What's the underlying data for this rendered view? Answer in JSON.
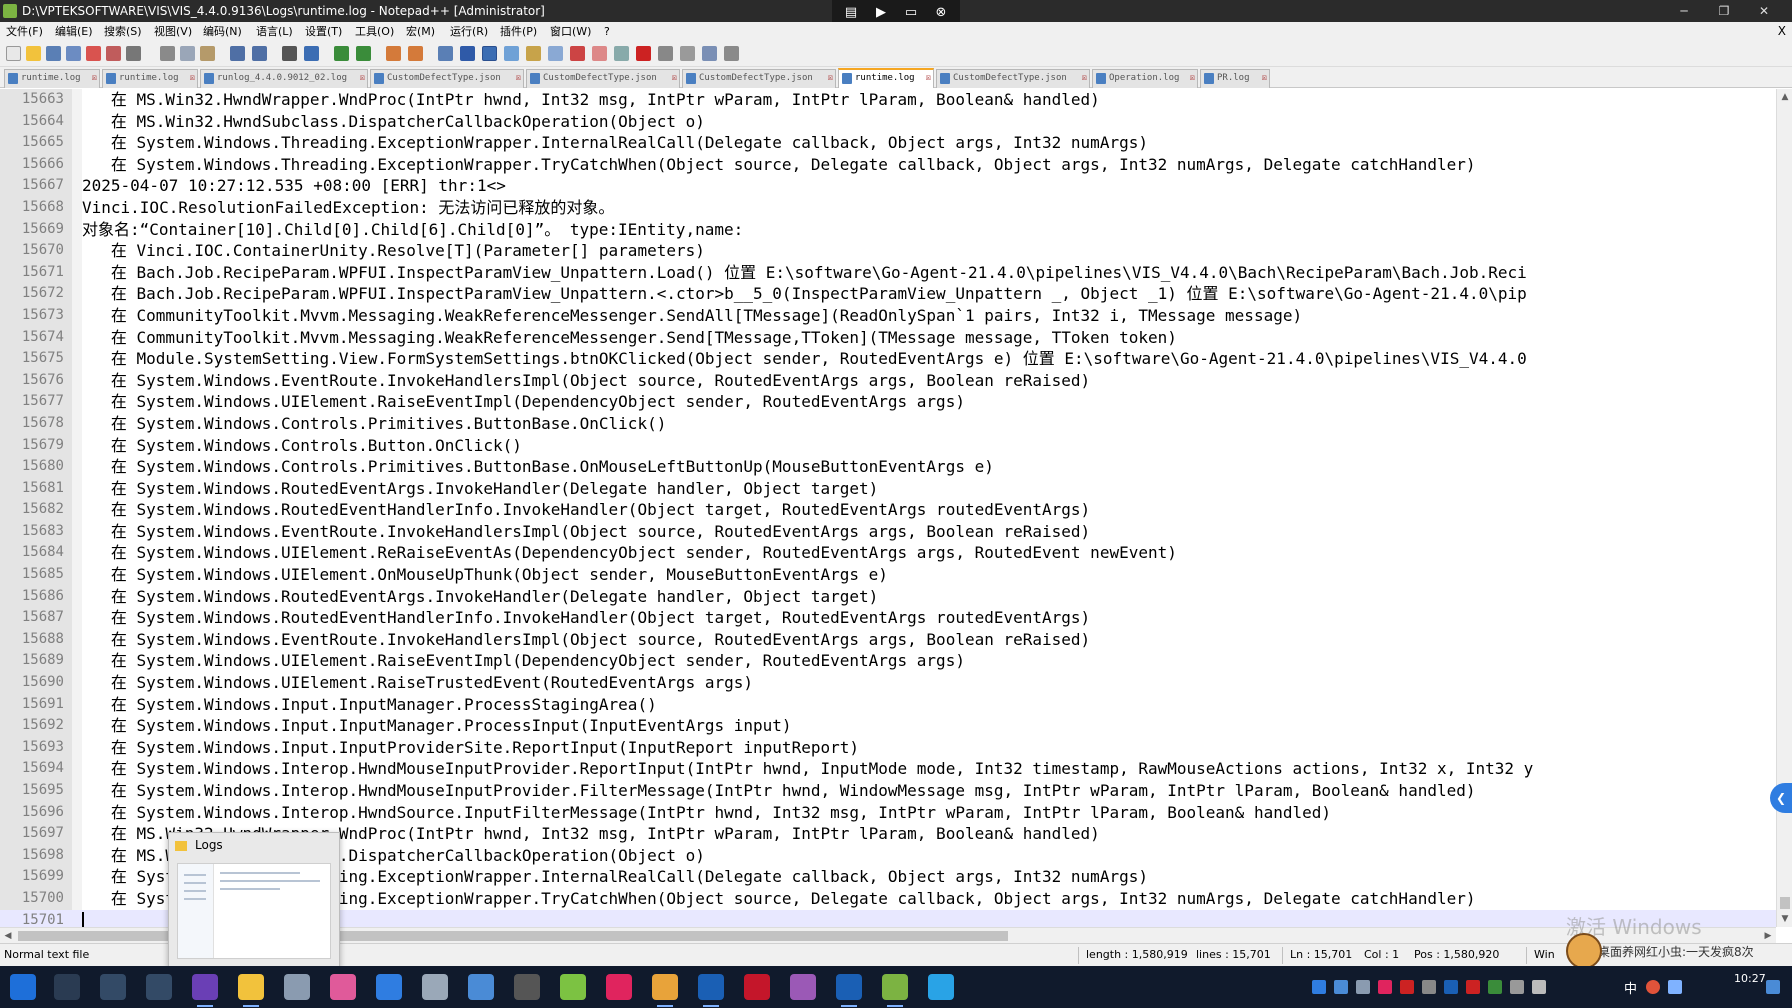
{
  "window": {
    "title": "D:\\VPTEKSOFTWARE\\VIS\\VIS_4.4.0.9136\\Logs\\runtime.log - Notepad++ [Administrator]",
    "minimize": "─",
    "maximize": "❐",
    "close": "✕"
  },
  "remote_bar": {
    "pin": "▤",
    "arrow": "▶",
    "screen": "▭",
    "close": "⊗"
  },
  "menu": {
    "items": [
      "文件(F)",
      "编辑(E)",
      "搜索(S)",
      "视图(V)",
      "编码(N)",
      "语言(L)",
      "设置(T)",
      "工具(O)",
      "宏(M)",
      "运行(R)",
      "插件(P)",
      "窗口(W)",
      "?"
    ],
    "close": "X"
  },
  "tabs": [
    {
      "label": "runtime.log",
      "close": "☒"
    },
    {
      "label": "runtime.log",
      "close": "☒"
    },
    {
      "label": "runlog_4.4.0.9012_02.log",
      "close": "☒"
    },
    {
      "label": "CustomDefectType.json",
      "close": "☒"
    },
    {
      "label": "CustomDefectType.json",
      "close": "☒"
    },
    {
      "label": "CustomDefectType.json",
      "close": "☒"
    },
    {
      "label": "runtime.log",
      "close": "☒"
    },
    {
      "label": "CustomDefectType.json",
      "close": "☒"
    },
    {
      "label": "Operation.log",
      "close": "☒"
    },
    {
      "label": "PR.log",
      "close": "☒"
    }
  ],
  "active_tab": 6,
  "editor": {
    "lines": [
      {
        "n": "15663",
        "t": "   在 MS.Win32.HwndWrapper.WndProc(IntPtr hwnd, Int32 msg, IntPtr wParam, IntPtr lParam, Boolean& handled)"
      },
      {
        "n": "15664",
        "t": "   在 MS.Win32.HwndSubclass.DispatcherCallbackOperation(Object o)"
      },
      {
        "n": "15665",
        "t": "   在 System.Windows.Threading.ExceptionWrapper.InternalRealCall(Delegate callback, Object args, Int32 numArgs)"
      },
      {
        "n": "15666",
        "t": "   在 System.Windows.Threading.ExceptionWrapper.TryCatchWhen(Object source, Delegate callback, Object args, Int32 numArgs, Delegate catchHandler)"
      },
      {
        "n": "15667",
        "t": "2025-04-07 10:27:12.535 +08:00 [ERR] thr:1<>"
      },
      {
        "n": "15668",
        "t": "Vinci.IOC.ResolutionFailedException: 无法访问已释放的对象。"
      },
      {
        "n": "15669",
        "t": "对象名:“Container[10].Child[0].Child[6].Child[0]”。 type:IEntity,name:"
      },
      {
        "n": "15670",
        "t": "   在 Vinci.IOC.ContainerUnity.Resolve[T](Parameter[] parameters)"
      },
      {
        "n": "15671",
        "t": "   在 Bach.Job.RecipeParam.WPFUI.InspectParamView_Unpattern.Load() 位置 E:\\software\\Go-Agent-21.4.0\\pipelines\\VIS_V4.4.0\\Bach\\RecipeParam\\Bach.Job.Reci"
      },
      {
        "n": "15672",
        "t": "   在 Bach.Job.RecipeParam.WPFUI.InspectParamView_Unpattern.<.ctor>b__5_0(InspectParamView_Unpattern _, Object _1) 位置 E:\\software\\Go-Agent-21.4.0\\pip"
      },
      {
        "n": "15673",
        "t": "   在 CommunityToolkit.Mvvm.Messaging.WeakReferenceMessenger.SendAll[TMessage](ReadOnlySpan`1 pairs, Int32 i, TMessage message)"
      },
      {
        "n": "15674",
        "t": "   在 CommunityToolkit.Mvvm.Messaging.WeakReferenceMessenger.Send[TMessage,TToken](TMessage message, TToken token)"
      },
      {
        "n": "15675",
        "t": "   在 Module.SystemSetting.View.FormSystemSettings.btnOKClicked(Object sender, RoutedEventArgs e) 位置 E:\\software\\Go-Agent-21.4.0\\pipelines\\VIS_V4.4.0"
      },
      {
        "n": "15676",
        "t": "   在 System.Windows.EventRoute.InvokeHandlersImpl(Object source, RoutedEventArgs args, Boolean reRaised)"
      },
      {
        "n": "15677",
        "t": "   在 System.Windows.UIElement.RaiseEventImpl(DependencyObject sender, RoutedEventArgs args)"
      },
      {
        "n": "15678",
        "t": "   在 System.Windows.Controls.Primitives.ButtonBase.OnClick()"
      },
      {
        "n": "15679",
        "t": "   在 System.Windows.Controls.Button.OnClick()"
      },
      {
        "n": "15680",
        "t": "   在 System.Windows.Controls.Primitives.ButtonBase.OnMouseLeftButtonUp(MouseButtonEventArgs e)"
      },
      {
        "n": "15681",
        "t": "   在 System.Windows.RoutedEventArgs.InvokeHandler(Delegate handler, Object target)"
      },
      {
        "n": "15682",
        "t": "   在 System.Windows.RoutedEventHandlerInfo.InvokeHandler(Object target, RoutedEventArgs routedEventArgs)"
      },
      {
        "n": "15683",
        "t": "   在 System.Windows.EventRoute.InvokeHandlersImpl(Object source, RoutedEventArgs args, Boolean reRaised)"
      },
      {
        "n": "15684",
        "t": "   在 System.Windows.UIElement.ReRaiseEventAs(DependencyObject sender, RoutedEventArgs args, RoutedEvent newEvent)"
      },
      {
        "n": "15685",
        "t": "   在 System.Windows.UIElement.OnMouseUpThunk(Object sender, MouseButtonEventArgs e)"
      },
      {
        "n": "15686",
        "t": "   在 System.Windows.RoutedEventArgs.InvokeHandler(Delegate handler, Object target)"
      },
      {
        "n": "15687",
        "t": "   在 System.Windows.RoutedEventHandlerInfo.InvokeHandler(Object target, RoutedEventArgs routedEventArgs)"
      },
      {
        "n": "15688",
        "t": "   在 System.Windows.EventRoute.InvokeHandlersImpl(Object source, RoutedEventArgs args, Boolean reRaised)"
      },
      {
        "n": "15689",
        "t": "   在 System.Windows.UIElement.RaiseEventImpl(DependencyObject sender, RoutedEventArgs args)"
      },
      {
        "n": "15690",
        "t": "   在 System.Windows.UIElement.RaiseTrustedEvent(RoutedEventArgs args)"
      },
      {
        "n": "15691",
        "t": "   在 System.Windows.Input.InputManager.ProcessStagingArea()"
      },
      {
        "n": "15692",
        "t": "   在 System.Windows.Input.InputManager.ProcessInput(InputEventArgs input)"
      },
      {
        "n": "15693",
        "t": "   在 System.Windows.Input.InputProviderSite.ReportInput(InputReport inputReport)"
      },
      {
        "n": "15694",
        "t": "   在 System.Windows.Interop.HwndMouseInputProvider.ReportInput(IntPtr hwnd, InputMode mode, Int32 timestamp, RawMouseActions actions, Int32 x, Int32 y"
      },
      {
        "n": "15695",
        "t": "   在 System.Windows.Interop.HwndMouseInputProvider.FilterMessage(IntPtr hwnd, WindowMessage msg, IntPtr wParam, IntPtr lParam, Boolean& handled)"
      },
      {
        "n": "15696",
        "t": "   在 System.Windows.Interop.HwndSource.InputFilterMessage(IntPtr hwnd, Int32 msg, IntPtr wParam, IntPtr lParam, Boolean& handled)"
      },
      {
        "n": "15697",
        "t": "   在 MS.Win32.HwndWrapper.WndProc(IntPtr hwnd, Int32 msg, IntPtr wParam, IntPtr lParam, Boolean& handled)"
      },
      {
        "n": "15698",
        "t": "   在 MS.Win32.HwndSubclass.DispatcherCallbackOperation(Object o)"
      },
      {
        "n": "15699",
        "t": "   在 System.Windows.Threading.ExceptionWrapper.InternalRealCall(Delegate callback, Object args, Int32 numArgs)"
      },
      {
        "n": "15700",
        "t": "   在 System.Windows.Threading.ExceptionWrapper.TryCatchWhen(Object source, Delegate callback, Object args, Int32 numArgs, Delegate catchHandler)"
      },
      {
        "n": "15701",
        "t": ""
      }
    ]
  },
  "statusbar": {
    "filetype": "Normal text file",
    "length": "length : 1,580,919",
    "lines": "lines : 15,701",
    "ln": "Ln : 15,701",
    "col": "Col : 1",
    "pos": "Pos : 1,580,920",
    "eol": "Win"
  },
  "preview": {
    "title": "Logs"
  },
  "watermark": "激活 Windows",
  "floating_ad": {
    "text": "桌面养网红小虫:一天发疯8次"
  },
  "taskbar": {
    "ime": "中",
    "clock": "10:27"
  },
  "colors": {
    "titlebar": "#2b2b2b",
    "active_tab_accent": "#f5a623",
    "current_line": "#e8e8ff",
    "taskbar": "#101a2c"
  }
}
